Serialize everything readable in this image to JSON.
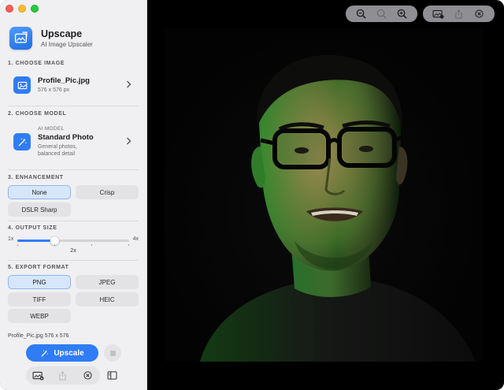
{
  "app": {
    "title": "Upscape",
    "subtitle": "AI Image Upscaler",
    "icon": "image-resize-icon",
    "accent": "#2f7cf6"
  },
  "sections": {
    "image": {
      "label": "1. CHOOSE IMAGE",
      "file_name": "Profile_Pic.jpg",
      "file_dims": "576 x 576 px"
    },
    "model": {
      "label": "2. CHOOSE MODEL",
      "kicker": "AI MODEL",
      "name": "Standard Photo",
      "desc_line1": "General photos,",
      "desc_line2": "balanced detail"
    },
    "enhancement": {
      "label": "3. ENHANCEMENT",
      "options": [
        "None",
        "Crisp",
        "DSLR Sharp"
      ],
      "selected": "None"
    },
    "output": {
      "label": "4. OUTPUT SIZE",
      "min": "1x",
      "max": "4x",
      "value_label": "2x",
      "value": 2,
      "range": [
        1,
        4
      ]
    },
    "export": {
      "label": "5. EXPORT FORMAT",
      "options": [
        "PNG",
        "JPEG",
        "TIFF",
        "HEIC",
        "WEBP"
      ],
      "selected": "PNG"
    }
  },
  "footer": {
    "file_info": "Profile_Pic.jpg  576 x 576",
    "upscale_label": "Upscale"
  }
}
